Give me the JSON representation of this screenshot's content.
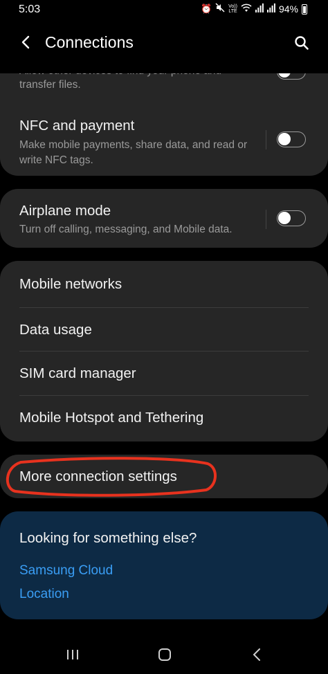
{
  "status": {
    "time": "5:03",
    "lte_label_top": "Vo))",
    "lte_label_bottom": "LTE",
    "battery": "94%"
  },
  "header": {
    "title": "Connections"
  },
  "partial_item": {
    "subtitle_line1": "Allow other devices to find your phone and",
    "subtitle_line2": "transfer files."
  },
  "nfc": {
    "title": "NFC and payment",
    "subtitle": "Make mobile payments, share data, and read or write NFC tags.",
    "enabled": false
  },
  "airplane": {
    "title": "Airplane mode",
    "subtitle": "Turn off calling, messaging, and Mobile data.",
    "enabled": false
  },
  "network_items": [
    {
      "label": "Mobile networks"
    },
    {
      "label": "Data usage"
    },
    {
      "label": "SIM card manager"
    },
    {
      "label": "Mobile Hotspot and Tethering"
    }
  ],
  "more_settings": {
    "label": "More connection settings"
  },
  "suggestions": {
    "heading": "Looking for something else?",
    "links": [
      {
        "label": "Samsung Cloud"
      },
      {
        "label": "Location"
      }
    ]
  },
  "colors": {
    "card": "#262626",
    "suggestion_card": "#0d2a45",
    "link": "#3a9ef5",
    "highlight": "#e8321e"
  }
}
